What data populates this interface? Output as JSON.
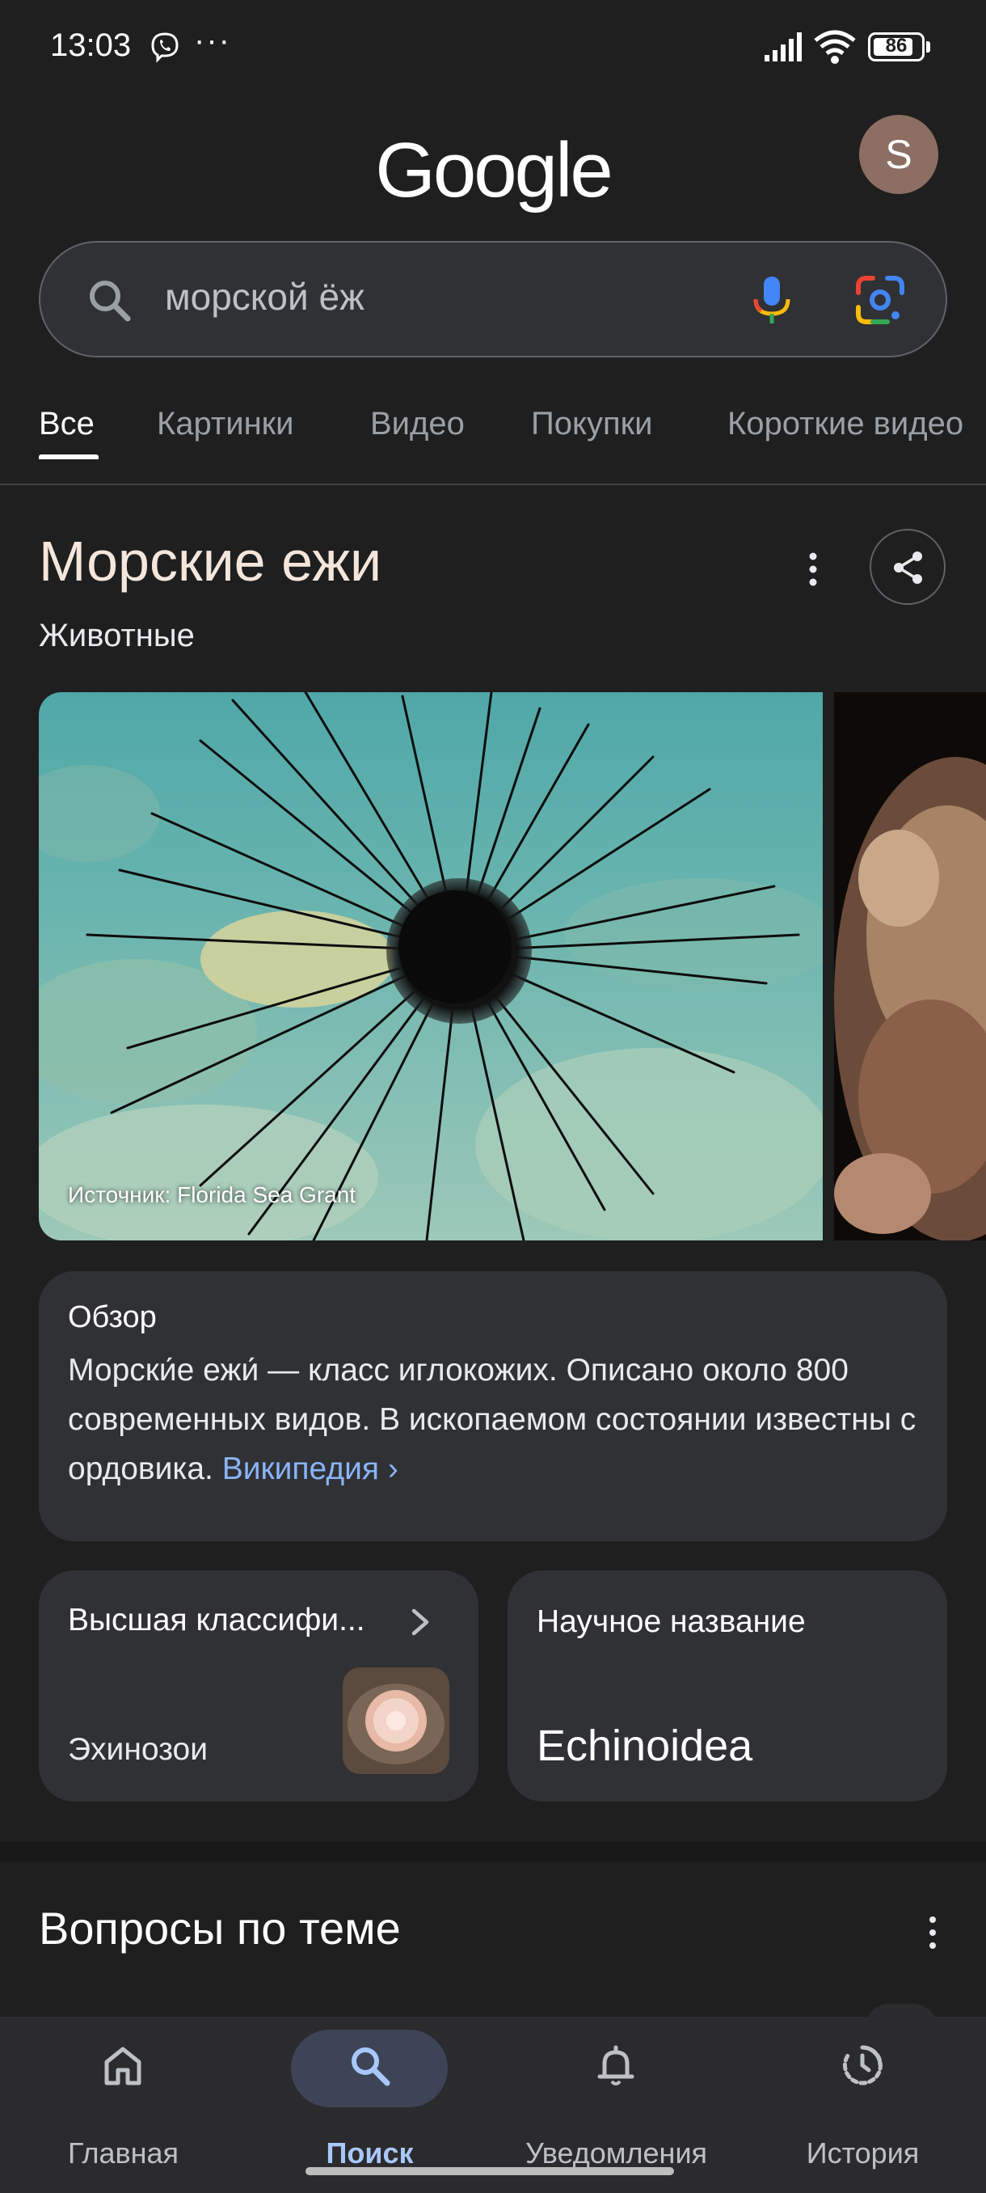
{
  "status_bar": {
    "time": "13:03",
    "more": "···",
    "battery": "86"
  },
  "header": {
    "logo_text": "Google",
    "avatar_letter": "S"
  },
  "search": {
    "query": "морской ёж"
  },
  "tabs": [
    {
      "label": "Все",
      "active": true
    },
    {
      "label": "Картинки",
      "active": false
    },
    {
      "label": "Видео",
      "active": false
    },
    {
      "label": "Покупки",
      "active": false
    },
    {
      "label": "Короткие видео",
      "active": false
    }
  ],
  "knowledge_panel": {
    "title": "Морские ежи",
    "subtitle": "Животные",
    "image_caption": "Источник: Florida Sea Grant",
    "overview": {
      "heading": "Обзор",
      "text": "Морски́е ежи́ — класс иглокожих. Описано около 800 современных видов. В ископаемом состоянии известны с ордовика. ",
      "link": "Википедия"
    },
    "classification": {
      "title": "Высшая классифи...",
      "value": "Эхинозои"
    },
    "scientific_name": {
      "title": "Научное название",
      "value": "Echinoidea"
    }
  },
  "related_questions": {
    "title": "Вопросы по теме"
  },
  "bottom_nav": [
    {
      "label": "Главная",
      "icon": "home-icon",
      "active": false
    },
    {
      "label": "Поиск",
      "icon": "search-icon",
      "active": true
    },
    {
      "label": "Уведомления",
      "icon": "bell-icon",
      "active": false
    },
    {
      "label": "История",
      "icon": "history-icon",
      "active": false
    }
  ],
  "colors": {
    "background": "#1f1f1f",
    "card": "#303134",
    "link": "#8ab4f8",
    "active_nav": "#a8c7fa",
    "title_accent": "#f5e6dc"
  }
}
